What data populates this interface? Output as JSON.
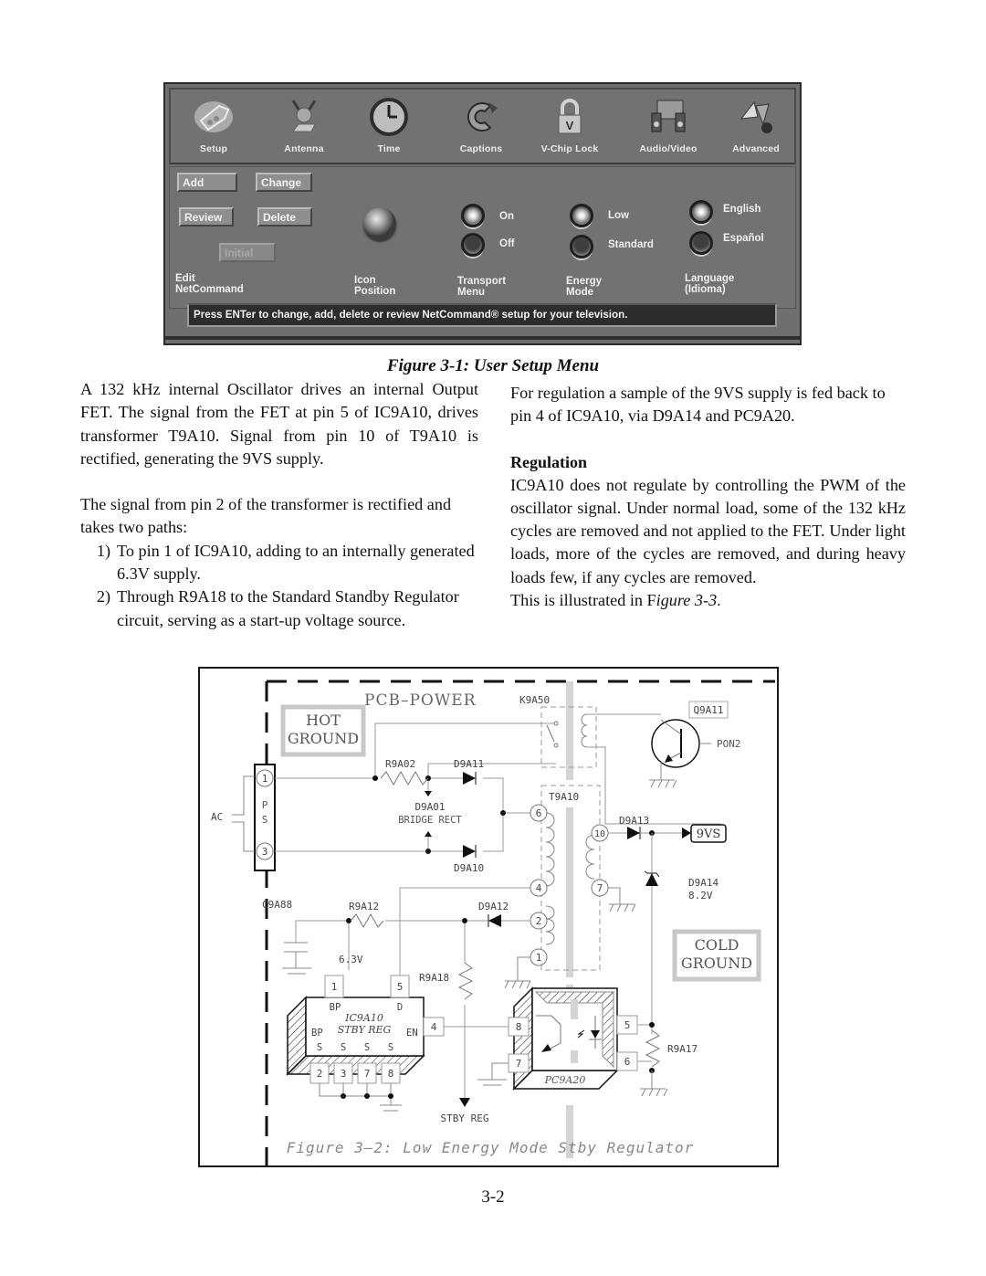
{
  "tv_menu": {
    "tabs": [
      {
        "label": "Setup",
        "icon": "setup-plug-icon",
        "selected": true
      },
      {
        "label": "Antenna",
        "icon": "antenna-icon"
      },
      {
        "label": "Time",
        "icon": "clock-icon"
      },
      {
        "label": "Captions",
        "icon": "captions-icon"
      },
      {
        "label": "V-Chip Lock",
        "icon": "padlock-icon"
      },
      {
        "label": "Audio/Video",
        "icon": "speakers-icon"
      },
      {
        "label": "Advanced",
        "icon": "advanced-tools-icon"
      }
    ],
    "buttons": {
      "add": "Add",
      "change": "Change",
      "review": "Review",
      "delete": "Delete",
      "initial": "Initial"
    },
    "groups": {
      "edit_netcommand": [
        "Edit",
        "NetCommand"
      ],
      "icon_position": [
        "Icon",
        "Position"
      ],
      "transport_menu": [
        "Transport",
        "Menu"
      ],
      "energy_mode": [
        "Energy",
        "Mode"
      ],
      "language": [
        "Language",
        "(Idioma)"
      ]
    },
    "radios": {
      "transport": [
        {
          "label": "On",
          "selected": true
        },
        {
          "label": "Off",
          "selected": false
        }
      ],
      "energy": [
        {
          "label": "Low",
          "selected": true
        },
        {
          "label": "Standard",
          "selected": false
        }
      ],
      "language": [
        {
          "label": "English",
          "selected": true
        },
        {
          "label": "Español",
          "selected": false
        }
      ]
    },
    "status_text": "Press ENTer to change, add, delete or review NetCommand®  setup for your television."
  },
  "figure1_caption": "Figure 3-1: User Setup Menu",
  "left_column": {
    "para1": "A 132 kHz internal Oscillator drives an internal Output FET.  The signal from the FET at pin 5 of IC9A10, drives transformer T9A10.  Signal from pin 10 of T9A10 is rectified, generating the 9VS supply.",
    "para2": "The signal from pin 2 of the transformer is rectified and takes two paths:",
    "list": [
      {
        "num": "1)",
        "text": "To pin 1 of  IC9A10, adding to an internally generated 6.3V supply."
      },
      {
        "num": "2)",
        "text": "Through R9A18 to the Standard Standby Regulator circuit, serving as a start-up voltage source."
      }
    ]
  },
  "right_column": {
    "para1": "For regulation a sample of the 9VS supply is fed back to pin 4 of IC9A10, via D9A14 and PC9A20.",
    "heading": "Regulation",
    "para2": "IC9A10 does not regulate by controlling the PWM of the oscillator signal.  Under normal load, some of the 132 kHz cycles are removed and not applied to the FET.  Under light loads, more of the cycles are removed, and during heavy loads few, if any cycles are removed.",
    "para3_prefix": "This is illustrated in F",
    "para3_italic": "igure 3-3",
    "para3_suffix": "."
  },
  "schematic": {
    "board_label": "PCB–POWER",
    "hot_ground": [
      "HOT",
      "GROUND"
    ],
    "cold_ground": [
      "COLD",
      "GROUND"
    ],
    "connector": {
      "label_p": "P",
      "label_s": "S",
      "pins": [
        "1",
        "3"
      ],
      "input": "AC"
    },
    "components": {
      "relay": "K9A50",
      "transistor": "Q9A11",
      "transistor_base": "PON2",
      "resistor_in": "R9A02",
      "diode_top": "D9A11",
      "bridge": [
        "D9A01",
        "BRIDGE  RECT"
      ],
      "diode_bottom": "D9A10",
      "transformer": "T9A10",
      "transformer_pins": [
        "6",
        "4",
        "2",
        "1",
        "10",
        "7"
      ],
      "diode_out": "D9A13",
      "output": "9VS",
      "zener": [
        "D9A14",
        "8.2V"
      ],
      "cap": "C9A88",
      "resistor_bp": "R9A12",
      "diode_aux": "D9A12",
      "voltage_bp": "6.3V",
      "resistor_stby": "R9A18",
      "stby_out": "STBY  REG",
      "ic": {
        "name": "IC9A10",
        "function": "STBY  REG",
        "top_pins": [
          "1",
          "5"
        ],
        "top_labels": [
          "BP",
          "D"
        ],
        "side_labels": [
          "BP",
          "EN"
        ],
        "side_pin": "4",
        "bottom_labels": [
          "S",
          "S",
          "S",
          "S"
        ],
        "bottom_pins": [
          "2",
          "3",
          "7",
          "8"
        ]
      },
      "opto": {
        "name": "PC9A20",
        "left_pins": [
          "8",
          "7"
        ],
        "right_pins": [
          "5",
          "6"
        ]
      },
      "resistor_fb": "R9A17"
    },
    "caption": "Figure  3–2:  Low  Energy  Mode  Stby  Regulator"
  },
  "page_number": "3-2"
}
